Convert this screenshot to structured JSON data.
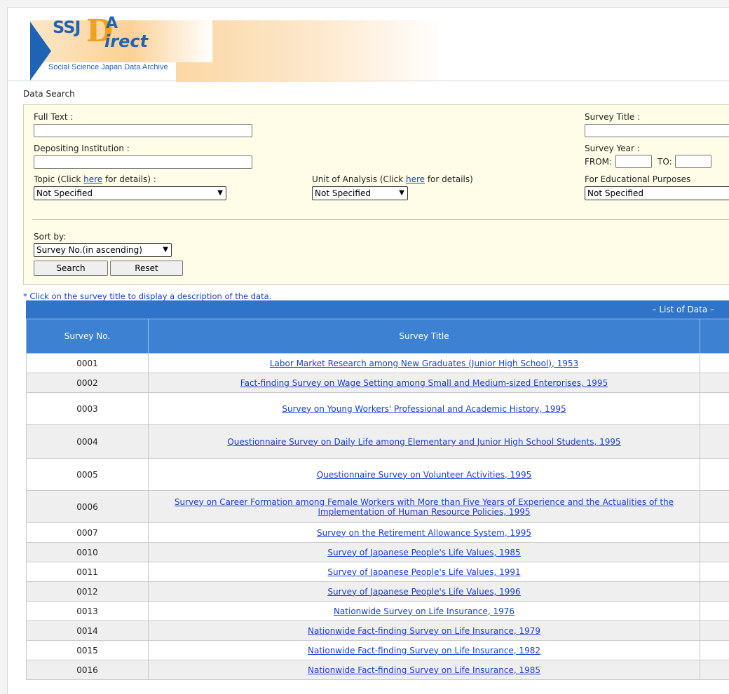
{
  "brand": {
    "logo_ssj": "SSJ",
    "logo_d": "D",
    "logo_a": "A",
    "logo_irect": "irect",
    "subtitle": "Social Science Japan Data Archive"
  },
  "page_title": "Data Search",
  "search": {
    "full_text_label": "Full Text :",
    "full_text_value": "",
    "depositing_label": "Depositing Institution :",
    "depositing_value": "",
    "topic_label_pre": "Topic (Click ",
    "topic_link": "here",
    "topic_label_post": " for details) :",
    "topic_value": "Not Specified",
    "unit_label_pre": "Unit of Analysis (Click ",
    "unit_link": "here",
    "unit_label_post": " for details)",
    "unit_value": "Not Specified",
    "survey_title_label": "Survey Title :",
    "survey_title_value": "",
    "survey_year_label": "Survey Year :",
    "from_label": "FROM:",
    "to_label": "TO:",
    "edu_label": "For Educational Purposes",
    "edu_value": "Not Specified",
    "sort_label": "Sort by:",
    "sort_value": "Survey No.(in ascending)",
    "search_button": "Search",
    "reset_button": "Reset"
  },
  "note": "* Click on the survey title to display a description of the data.",
  "table": {
    "list_label": "–  List of Data  –",
    "col_no": "Survey No.",
    "col_title": "Survey Title",
    "rows": [
      {
        "no": "0001",
        "title": "Labor Market Research among New Graduates (Junior High School), 1953"
      },
      {
        "no": "0002",
        "title": "Fact-finding Survey on Wage Setting among Small and Medium-sized Enterprises, 1995"
      },
      {
        "no": "0003",
        "title": "Survey on Young Workers' Professional and Academic History, 1995"
      },
      {
        "no": "0004",
        "title": "Questionnaire Survey on Daily Life among Elementary and Junior High School Students, 1995"
      },
      {
        "no": "0005",
        "title": "Questionnaire Survey on Volunteer Activities, 1995"
      },
      {
        "no": "0006",
        "title": "Survey on Career Formation among Female Workers with More than Five Years of Experience and the Actualities of the Implementation of Human Resource Policies, 1995"
      },
      {
        "no": "0007",
        "title": "Survey on the Retirement Allowance System, 1995"
      },
      {
        "no": "0010",
        "title": "Survey of Japanese People's Life Values, 1985"
      },
      {
        "no": "0011",
        "title": "Survey of Japanese People's Life Values, 1991"
      },
      {
        "no": "0012",
        "title": "Survey of Japanese People's Life Values, 1996"
      },
      {
        "no": "0013",
        "title": "Nationwide Survey on Life Insurance, 1976"
      },
      {
        "no": "0014",
        "title": "Nationwide Fact-finding Survey on Life Insurance, 1979"
      },
      {
        "no": "0015",
        "title": "Nationwide Fact-finding Survey on Life Insurance, 1982"
      },
      {
        "no": "0016",
        "title": "Nationwide Fact-finding Survey on Life Insurance, 1985"
      }
    ]
  },
  "colors": {
    "brand_blue": "#1f63b4",
    "header_blue": "#3d82d2",
    "link": "#1a3cd8",
    "search_bg": "#fffde8"
  }
}
